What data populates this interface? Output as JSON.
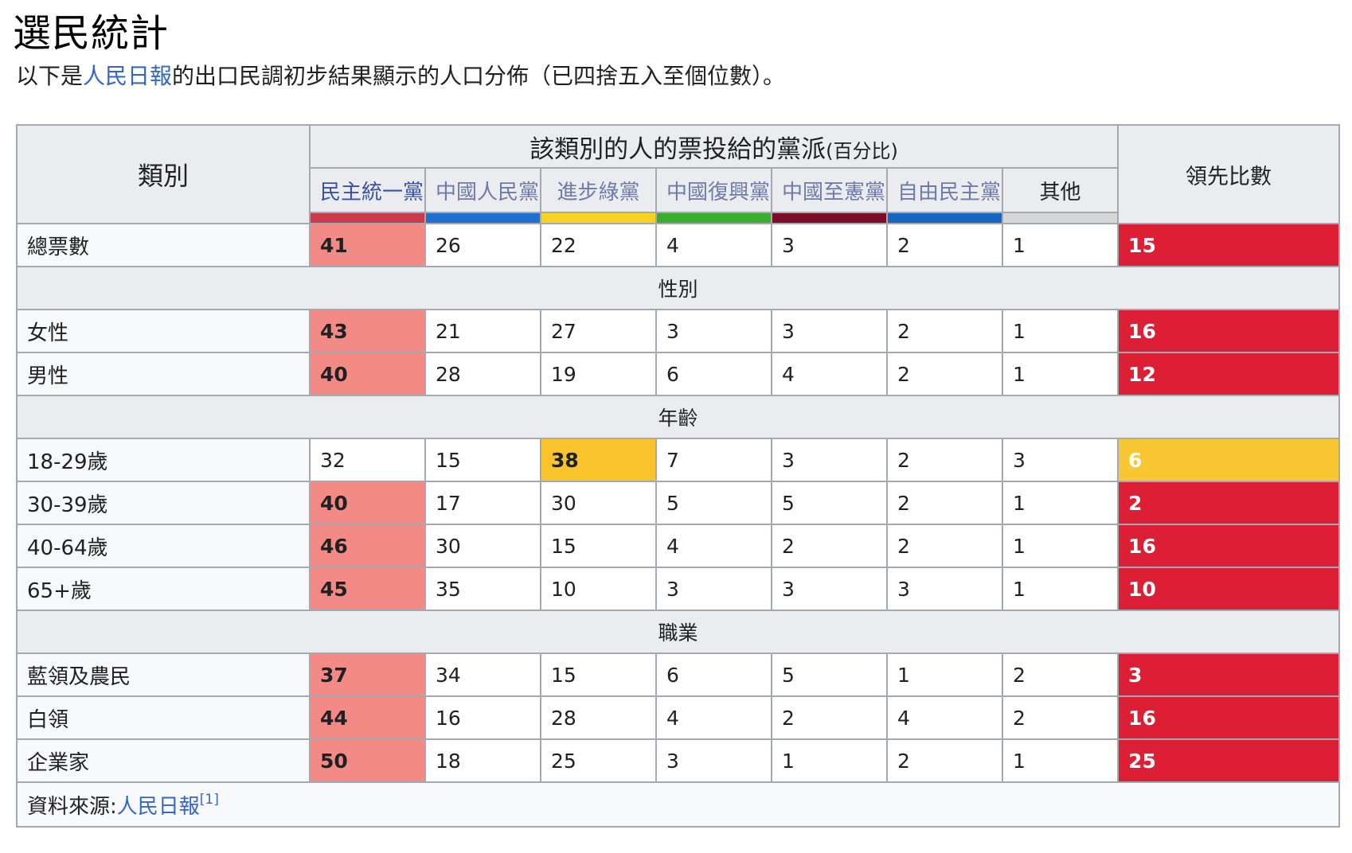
{
  "heading": "選民統計",
  "intro": {
    "before": "以下是",
    "link": "人民日報",
    "after": "的出口民調初步結果顯示的人口分佈（已四捨五入至個位數）。"
  },
  "table": {
    "category_header": "類別",
    "group_header": "該類別的人的票投給的黨派",
    "group_header_note": "(百分比)",
    "lead_header": "領先比數",
    "parties": [
      {
        "name": "民主統一黨",
        "color": "#c73b4a"
      },
      {
        "name": "中國人民黨",
        "color": "#1f6fd1"
      },
      {
        "name": "進步綠黨",
        "color": "#f7d21e"
      },
      {
        "name": "中國復興黨",
        "color": "#3cac2e"
      },
      {
        "name": "中國至憲黨",
        "color": "#7b0d26"
      },
      {
        "name": "自由民主黨",
        "color": "#1765c0"
      },
      {
        "name": "其他",
        "color": "#d4d6d8"
      }
    ],
    "total": {
      "label": "總票數",
      "values": [
        "41",
        "26",
        "22",
        "4",
        "3",
        "2",
        "1"
      ],
      "lead": "15"
    },
    "sections": [
      {
        "title": "性別",
        "rows": [
          {
            "label": "女性",
            "values": [
              "43",
              "21",
              "27",
              "3",
              "3",
              "2",
              "1"
            ],
            "lead": "16"
          },
          {
            "label": "男性",
            "values": [
              "40",
              "28",
              "19",
              "6",
              "4",
              "2",
              "1"
            ],
            "lead": "12"
          }
        ]
      },
      {
        "title": "年齡",
        "rows": [
          {
            "label": "18-29歲",
            "values": [
              "32",
              "15",
              "38",
              "7",
              "3",
              "2",
              "3"
            ],
            "lead": "6"
          },
          {
            "label": "30-39歲",
            "values": [
              "40",
              "17",
              "30",
              "5",
              "5",
              "2",
              "1"
            ],
            "lead": "2"
          },
          {
            "label": "40-64歲",
            "values": [
              "46",
              "30",
              "15",
              "4",
              "2",
              "2",
              "1"
            ],
            "lead": "16"
          },
          {
            "label": "65+歲",
            "values": [
              "45",
              "35",
              "10",
              "3",
              "3",
              "3",
              "1"
            ],
            "lead": "10"
          }
        ]
      },
      {
        "title": "職業",
        "rows": [
          {
            "label": "藍領及農民",
            "values": [
              "37",
              "34",
              "15",
              "6",
              "5",
              "1",
              "2"
            ],
            "lead": "3"
          },
          {
            "label": "白領",
            "values": [
              "44",
              "16",
              "28",
              "4",
              "2",
              "4",
              "2"
            ],
            "lead": "16"
          },
          {
            "label": "企業家",
            "values": [
              "50",
              "18",
              "25",
              "3",
              "1",
              "2",
              "1"
            ],
            "lead": "25"
          }
        ]
      }
    ],
    "source_label": "資料來源:",
    "source_link": "人民日報",
    "source_ref": "[1]"
  },
  "colors": {
    "win_red": "#f48a85",
    "win_yellow": "#f9c42b",
    "lead_red": "#dc1f34",
    "lead_yellow": "#f8c732",
    "link": "#3366cc"
  }
}
